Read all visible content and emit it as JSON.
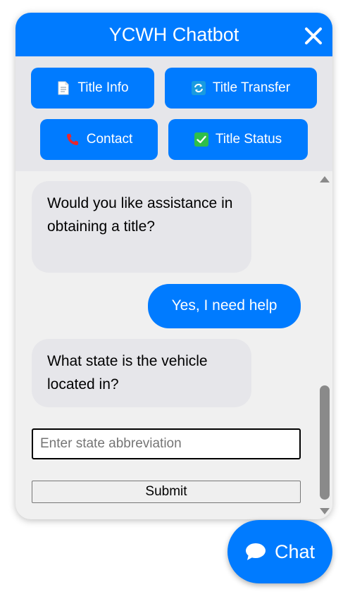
{
  "header": {
    "title": "YCWH Chatbot",
    "close_icon": "close-icon"
  },
  "quick_actions": [
    {
      "label": "Title Info",
      "icon": "document-icon"
    },
    {
      "label": "Title Transfer",
      "icon": "transfer-icon"
    },
    {
      "label": "Contact",
      "icon": "phone-icon"
    },
    {
      "label": "Title Status",
      "icon": "checkmark-icon"
    }
  ],
  "messages": [
    {
      "sender": "bot",
      "text": "Would you like assistance in obtaining a title?"
    },
    {
      "sender": "user",
      "text": "Yes, I need help"
    },
    {
      "sender": "bot",
      "text": "What state is the vehicle located in?"
    }
  ],
  "input": {
    "placeholder": "Enter state abbreviation",
    "value": ""
  },
  "submit": {
    "label": "Submit"
  },
  "launcher": {
    "label": "Chat",
    "icon": "speech-bubble-icon"
  },
  "colors": {
    "accent": "#007bff",
    "bot_bubble": "#e6e6ea",
    "panel_bg": "#f0f0f0"
  }
}
